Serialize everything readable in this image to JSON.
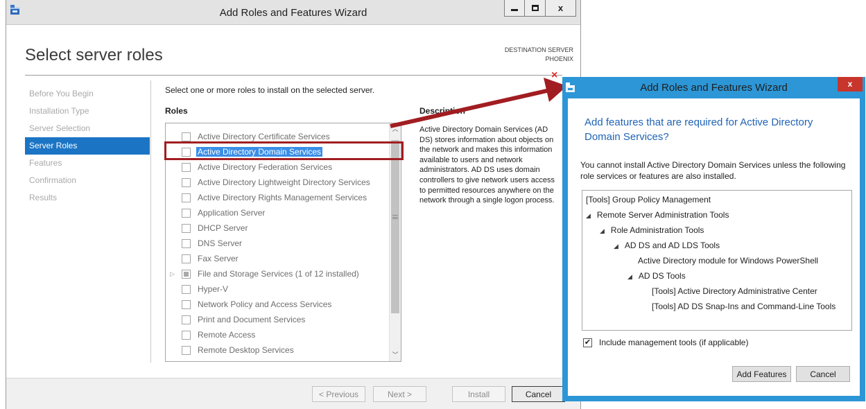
{
  "main_window": {
    "title": "Add Roles and Features Wizard",
    "heading": "Select server roles",
    "destination": {
      "label": "DESTINATION SERVER",
      "server": "PHOENIX"
    },
    "nav": [
      {
        "label": "Before You Begin",
        "active": false
      },
      {
        "label": "Installation Type",
        "active": false
      },
      {
        "label": "Server Selection",
        "active": false
      },
      {
        "label": "Server Roles",
        "active": true
      },
      {
        "label": "Features",
        "active": false
      },
      {
        "label": "Confirmation",
        "active": false
      },
      {
        "label": "Results",
        "active": false
      }
    ],
    "instruction": "Select one or more roles to install on the selected server.",
    "roles_header": "Roles",
    "roles": [
      {
        "label": "Active Directory Certificate Services"
      },
      {
        "label": "Active Directory Domain Services"
      },
      {
        "label": "Active Directory Federation Services"
      },
      {
        "label": "Active Directory Lightweight Directory Services"
      },
      {
        "label": "Active Directory Rights Management Services"
      },
      {
        "label": "Application Server"
      },
      {
        "label": "DHCP Server"
      },
      {
        "label": "DNS Server"
      },
      {
        "label": "Fax Server"
      },
      {
        "label": "File and Storage Services (1 of 12 installed)"
      },
      {
        "label": "Hyper-V"
      },
      {
        "label": "Network Policy and Access Services"
      },
      {
        "label": "Print and Document Services"
      },
      {
        "label": "Remote Access"
      },
      {
        "label": "Remote Desktop Services"
      }
    ],
    "description_header": "Description",
    "description": "Active Directory Domain Services (AD DS) stores information about objects on the network and makes this information available to users and network administrators. AD DS uses domain controllers to give network users access to permitted resources anywhere on the network through a single logon process.",
    "buttons": {
      "previous": "< Previous",
      "next": "Next >",
      "install": "Install",
      "cancel": "Cancel"
    },
    "window_controls": {
      "close": "x"
    }
  },
  "marker": {
    "close_symbol": "×"
  },
  "dialog": {
    "title": "Add Roles and Features Wizard",
    "close": "x",
    "heading": "Add features that are required for Active Directory Domain Services?",
    "text": "You cannot install Active Directory Domain Services unless the following role services or features are also installed.",
    "tree": [
      {
        "label": "[Tools] Group Policy Management",
        "expander": ""
      },
      {
        "label": "Remote Server Administration Tools",
        "expander": "◢"
      },
      {
        "label": "Role Administration Tools",
        "expander": "◢"
      },
      {
        "label": "AD DS and AD LDS Tools",
        "expander": "◢"
      },
      {
        "label": "Active Directory module for Windows PowerShell",
        "expander": ""
      },
      {
        "label": "AD DS Tools",
        "expander": "◢"
      },
      {
        "label": "[Tools] Active Directory Administrative Center",
        "expander": ""
      },
      {
        "label": "[Tools] AD DS Snap-Ins and Command-Line Tools",
        "expander": ""
      }
    ],
    "include_tools": {
      "label": "Include management tools (if applicable)",
      "checked": true,
      "mark": "✔"
    },
    "buttons": {
      "add_features": "Add Features",
      "cancel": "Cancel"
    }
  },
  "colors": {
    "accent": "#1b75c4",
    "dialog_frame": "#2d96d6",
    "highlight_red": "#a11d21",
    "dialog_heading": "#1f63b4"
  }
}
